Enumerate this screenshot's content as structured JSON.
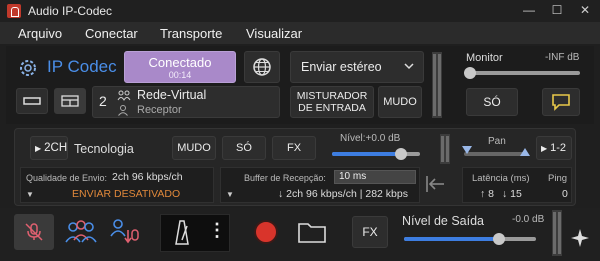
{
  "window": {
    "title": "Audio IP-Codec",
    "minimize": "—",
    "maximize": "☐",
    "close": "✕"
  },
  "menu": [
    "Arquivo",
    "Conectar",
    "Transporte",
    "Visualizar"
  ],
  "brand": {
    "name": "IP Codec",
    "accent": "#4a8ee8"
  },
  "connection": {
    "status": "Conectado",
    "timer": "00:14",
    "status_color": "#a989c9"
  },
  "stereo_select": {
    "value": "Enviar estéreo"
  },
  "monitor": {
    "label": "Monitor",
    "level": "-INF dB",
    "value_fraction": 0.0
  },
  "route": {
    "number": "2",
    "name": "Rede-Virtual",
    "role": "Receptor"
  },
  "mixer_button": "MISTURADOR DE ENTRADA",
  "mute_label": "MUDO",
  "solo_label": "SÓ",
  "channel": {
    "format": "2CH",
    "name": "Tecnologia",
    "mute": "MUDO",
    "solo": "SÓ",
    "fx": "FX",
    "level_label": "Nível:+0.0 dB",
    "level_fraction": 0.78,
    "pan_label": "Pan",
    "routing": "1-2",
    "send_quality_label": "Qualidade de Envio:",
    "send_quality_value": "2ch 96 kbps/ch",
    "send_disabled": "ENVIAR DESATIVADO",
    "buffer_label": "Buffer de Recepção:",
    "buffer_value": "10 ms",
    "receive_info": "↓ 2ch 96 kbps/ch | 282 kbps",
    "latency_label": "Latência (ms)",
    "latency_up": "↑ 8",
    "latency_down": "↓ 15",
    "ping_label": "Ping",
    "ping_value": "0"
  },
  "bottom": {
    "fx": "FX",
    "output_label": "Nível de Saída",
    "output_level": "-0.0 dB",
    "output_fraction": 0.72,
    "more": "⋮"
  },
  "colors": {
    "record": "#d9342b",
    "mic_muted": "#e06070",
    "orange": "#e0883a",
    "blue": "#3d7de0"
  }
}
